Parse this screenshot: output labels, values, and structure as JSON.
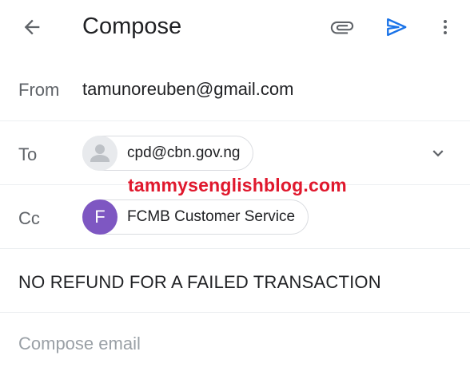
{
  "header": {
    "title": "Compose",
    "icons": [
      "back-arrow-icon",
      "paperclip-icon",
      "send-icon",
      "more-vert-icon"
    ],
    "send_color": "#1a73e8"
  },
  "from": {
    "label": "From",
    "value": "tamunoreuben@gmail.com"
  },
  "to": {
    "label": "To",
    "recipient": "cpd@cbn.gov.ng"
  },
  "cc": {
    "label": "Cc",
    "avatar_letter": "F",
    "avatar_color": "#7e57c2",
    "recipient": "FCMB Customer Service"
  },
  "watermark": "tammysenglishblog.com",
  "subject": "NO REFUND FOR A FAILED TRANSACTION",
  "body": {
    "placeholder": "Compose email"
  }
}
